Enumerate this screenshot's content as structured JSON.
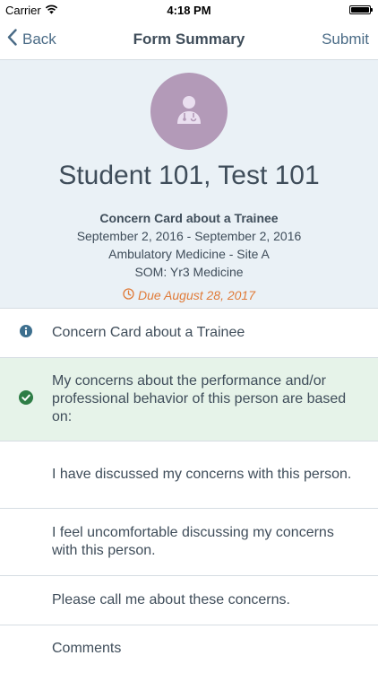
{
  "status_bar": {
    "carrier": "Carrier",
    "time": "4:18 PM"
  },
  "nav": {
    "back_label": "Back",
    "title": "Form Summary",
    "submit_label": "Submit"
  },
  "header": {
    "name": "Student 101, Test 101",
    "card_title": "Concern Card about a Trainee",
    "dates": "September 2, 2016 - September 2, 2016",
    "site": "Ambulatory Medicine - Site A",
    "course": "SOM: Yr3 Medicine",
    "due": "Due August 28, 2017",
    "avatar_color": "#b39ab8",
    "due_color": "#e07b39"
  },
  "rows": [
    {
      "text": "Concern Card about a Trainee",
      "icon": "info-icon"
    },
    {
      "text": "My concerns about the performance and/or professional behavior of this person are based on:",
      "icon": "check-circle-icon"
    },
    {
      "text": "I have discussed my concerns with this person."
    },
    {
      "text": "I feel uncomfortable discussing my concerns with this person."
    },
    {
      "text": "Please call me about these concerns."
    },
    {
      "text": "Comments"
    }
  ]
}
